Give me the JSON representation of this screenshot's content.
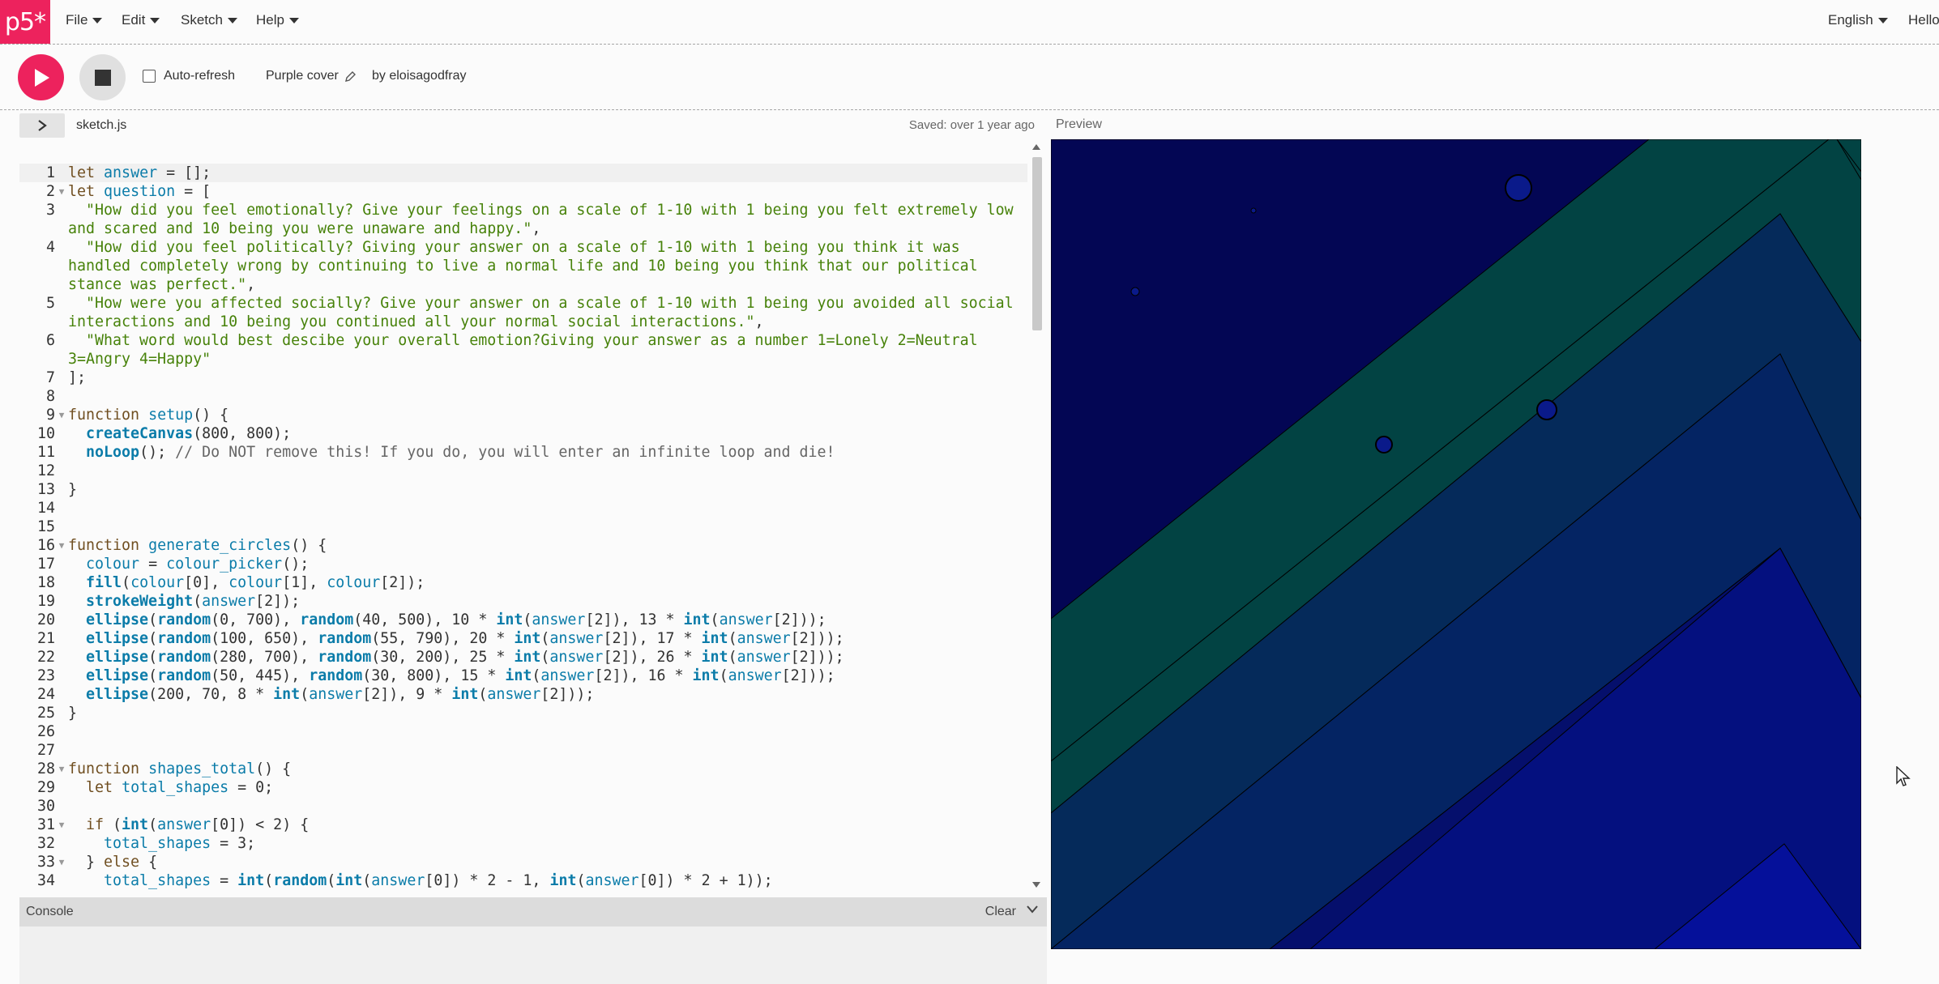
{
  "nav": {
    "logo": "p5*",
    "menus": [
      "File",
      "Edit",
      "Sketch",
      "Help"
    ],
    "language": "English",
    "user": "Hello"
  },
  "toolbar": {
    "auto_refresh_label": "Auto-refresh",
    "auto_refresh_checked": false,
    "sketch_name": "Purple cover",
    "owner": "by eloisagodfray"
  },
  "editor": {
    "file_name": "sketch.js",
    "saved_status": "Saved: over 1 year ago",
    "preview_label": "Preview",
    "lines": [
      "1",
      "2",
      "3",
      "4",
      "5",
      "6",
      "7",
      "8",
      "9",
      "10",
      "11",
      "12",
      "13",
      "14",
      "15",
      "16",
      "17",
      "18",
      "19",
      "20",
      "21",
      "22",
      "23",
      "24",
      "25",
      "26",
      "27",
      "28",
      "29",
      "30",
      "31",
      "32",
      "33",
      "34"
    ]
  },
  "console": {
    "title": "Console",
    "clear_label": "Clear"
  },
  "icons": {
    "play": "play-icon",
    "stop": "stop-icon",
    "edit": "pencil-icon",
    "expand": "chevron-right-icon",
    "console_toggle": "chevron-down-icon"
  },
  "colors": {
    "accent": "#ed225d",
    "stripe_teal": "#024343",
    "bg_navy": "#030654"
  }
}
